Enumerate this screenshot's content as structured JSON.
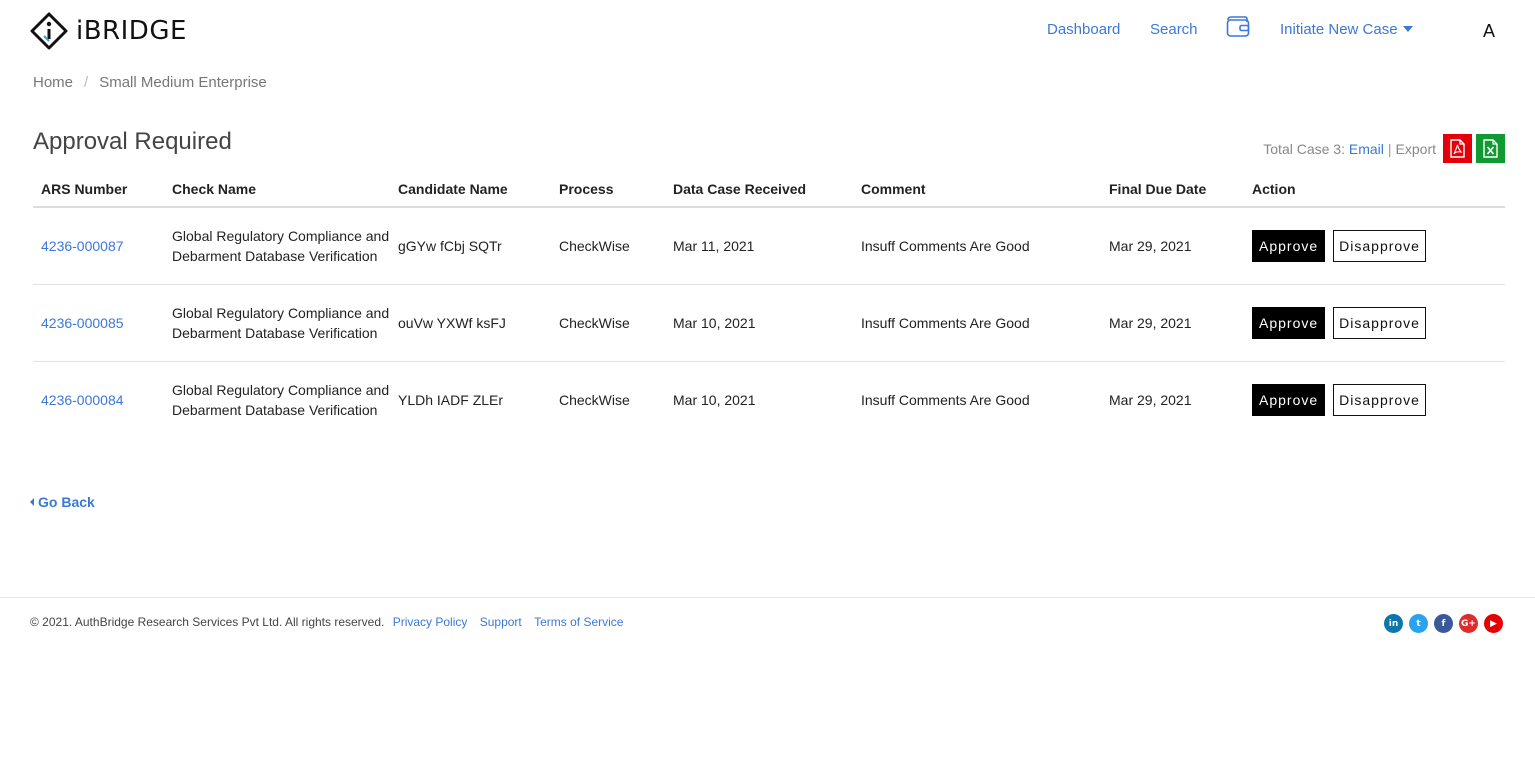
{
  "brand": {
    "name": "iBRIDGE"
  },
  "nav": {
    "dashboard": "Dashboard",
    "search": "Search",
    "wallet_icon": "wallet-icon",
    "initiate": "Initiate New Case",
    "user_initial": "A"
  },
  "breadcrumb": {
    "home": "Home",
    "current": "Small Medium Enterprise"
  },
  "page": {
    "title": "Approval Required"
  },
  "toolbar": {
    "total_label": "Total Case 3:",
    "email": "Email",
    "separator": "|",
    "export_label": "Export",
    "pdf_icon": "pdf-icon",
    "excel_icon": "excel-icon"
  },
  "table": {
    "headers": [
      "ARS Number",
      "Check Name",
      "Candidate Name",
      "Process",
      "Data Case Received",
      "Comment",
      "Final Due Date",
      "Action"
    ],
    "rows": [
      {
        "ars": "4236-000087",
        "check": "Global Regulatory Compliance and Debarment Database Verification",
        "candidate": "gGYw fCbj SQTr",
        "process": "CheckWise",
        "received": "Mar 11, 2021",
        "comment": "Insuff Comments Are Good",
        "due": "Mar 29, 2021"
      },
      {
        "ars": "4236-000085",
        "check": "Global Regulatory Compliance and Debarment Database Verification",
        "candidate": "ouVw YXWf ksFJ",
        "process": "CheckWise",
        "received": "Mar 10, 2021",
        "comment": "Insuff Comments Are Good",
        "due": "Mar 29, 2021"
      },
      {
        "ars": "4236-000084",
        "check": "Global Regulatory Compliance and Debarment Database Verification",
        "candidate": "YLDh IADF ZLEr",
        "process": "CheckWise",
        "received": "Mar 10, 2021",
        "comment": "Insuff Comments Are Good",
        "due": "Mar 29, 2021"
      }
    ],
    "approve_label": "Approve",
    "disapprove_label": "Disapprove"
  },
  "go_back": "Go Back",
  "footer": {
    "copyright": "© 2021. AuthBridge Research Services Pvt Ltd. All rights reserved.",
    "privacy": "Privacy Policy",
    "support": "Support",
    "terms": "Terms of Service",
    "social": [
      {
        "icon": "linkedin-icon",
        "glyph": "in",
        "color": "#0e76a8"
      },
      {
        "icon": "twitter-icon",
        "glyph": "t",
        "color": "#2aa3ef"
      },
      {
        "icon": "facebook-icon",
        "glyph": "f",
        "color": "#3b5998"
      },
      {
        "icon": "googleplus-icon",
        "glyph": "G+",
        "color": "#dd2c2c"
      },
      {
        "icon": "youtube-icon",
        "glyph": "▶",
        "color": "#e60000"
      }
    ]
  },
  "colors": {
    "link": "#3b78d8",
    "pdf": "#e3000b",
    "excel": "#119a32"
  }
}
